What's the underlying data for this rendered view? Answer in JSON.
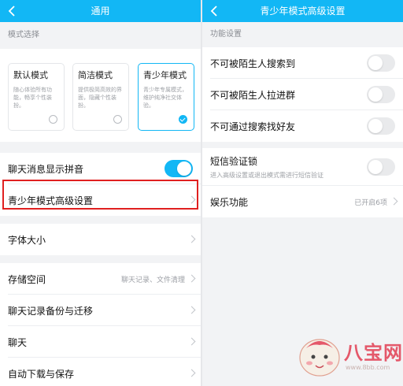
{
  "left": {
    "title": "通用",
    "section_label": "模式选择",
    "modes": [
      {
        "title": "默认模式",
        "desc": "随心体验所有功能，畅享个性装扮。",
        "selected": false
      },
      {
        "title": "简洁模式",
        "desc": "提供极简高效的界面，隐藏个性装扮。",
        "selected": false
      },
      {
        "title": "青少年模式",
        "desc": "青少年专属模式，维护纯净社交体验。",
        "selected": true
      }
    ],
    "pinyin": {
      "label": "聊天消息显示拼音",
      "on": true
    },
    "teen_settings": {
      "label": "青少年模式高级设置"
    },
    "font_size": {
      "label": "字体大小"
    },
    "storage": {
      "label": "存储空间",
      "value": "聊天记录、文件清理"
    },
    "backup": {
      "label": "聊天记录备份与迁移"
    },
    "chat": {
      "label": "聊天"
    },
    "auto_download": {
      "label": "自动下载与保存"
    }
  },
  "right": {
    "title": "青少年模式高级设置",
    "section_label": "功能设置",
    "items": [
      {
        "label": "不可被陌生人搜索到",
        "on": false
      },
      {
        "label": "不可被陌生人拉进群",
        "on": false
      },
      {
        "label": "不可通过搜索找好友",
        "on": false
      }
    ],
    "sms_lock": {
      "label": "短信验证锁",
      "desc": "进入高级设置或退出模式需进行短信验证",
      "on": false
    },
    "entertainment": {
      "label": "娱乐功能",
      "value": "已开启6项"
    }
  },
  "watermark": {
    "text": "八宝网",
    "url": "www.8bb.com"
  },
  "colors": {
    "accent": "#12b7f5",
    "highlight": "#e02020",
    "background": "#f2f3f5"
  }
}
